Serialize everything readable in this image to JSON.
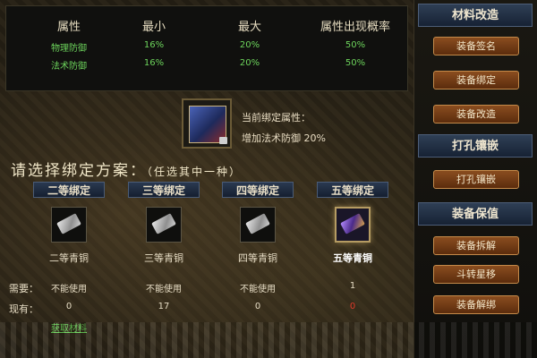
{
  "attributes": {
    "headers": [
      "属性",
      "最小",
      "最大",
      "属性出现概率"
    ],
    "rows": [
      [
        "物理防御",
        "16%",
        "20%",
        "50%"
      ],
      [
        "法术防御",
        "16%",
        "20%",
        "50%"
      ]
    ]
  },
  "current_binding": {
    "label": "当前绑定属性：",
    "value": "增加法术防御 20%"
  },
  "choose": {
    "title": "请选择绑定方案：",
    "subtitle": "（任选其中一种）"
  },
  "row_labels": {
    "need": "需要：",
    "have": "现有："
  },
  "tiers": [
    {
      "header": "二等绑定",
      "material": "二等青铜",
      "need": "不能使用",
      "have": "0",
      "icon": "silver-ingot-icon"
    },
    {
      "header": "三等绑定",
      "material": "三等青铜",
      "need": "不能使用",
      "have": "17",
      "icon": "silver-ingot-icon"
    },
    {
      "header": "四等绑定",
      "material": "四等青铜",
      "need": "不能使用",
      "have": "0",
      "icon": "silver-ingot-icon"
    },
    {
      "header": "五等绑定",
      "material": "五等青铜",
      "need": "1",
      "have": "0",
      "icon": "purple-crystal-icon",
      "selected": true,
      "have_color": "#e03a2a"
    }
  ],
  "material_link": "获取材料",
  "sidebar": {
    "sections": [
      {
        "title": "材料改造",
        "buttons": [
          "装备签名",
          "装备绑定",
          "装备改造"
        ]
      },
      {
        "title": "打孔镶嵌",
        "buttons": [
          "打孔镶嵌"
        ]
      },
      {
        "title": "装备保值",
        "buttons": [
          "装备拆解",
          "斗转星移",
          "装备解绑"
        ]
      }
    ]
  },
  "colors": {
    "green_text": "#6dd45c",
    "button_orange": "#8a4d1f",
    "header_blue": "#2f3f55",
    "insufficient_red": "#e03a2a"
  }
}
